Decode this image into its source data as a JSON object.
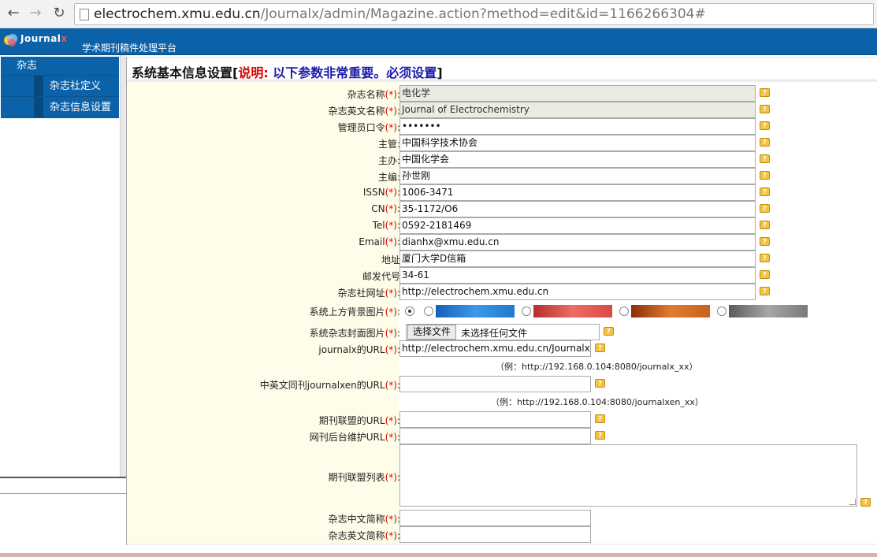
{
  "browser": {
    "url_host": "electrochem.xmu.edu.cn",
    "url_path": "/Journalx/admin/Magazine.action?method=edit&id=1166266304#"
  },
  "app": {
    "logo_text": "Journal",
    "logo_x": "x",
    "subtitle": "学术期刊稿件处理平台"
  },
  "sidebar": {
    "top": "杂志",
    "items": [
      {
        "label": "杂志社定义"
      },
      {
        "label": "杂志信息设置"
      }
    ]
  },
  "page": {
    "title_main": "系统基本信息设置[",
    "title_note": "说明:",
    "title_note_body": " 以下参数非常重要。必须设置",
    "title_end": "]"
  },
  "required_mark": "(*)",
  "help_glyph": "?",
  "fields": [
    {
      "label": "杂志名称",
      "required": true,
      "value": "电化学",
      "readonly": true
    },
    {
      "label": "杂志英文名称",
      "required": true,
      "value": "Journal of Electrochemistry",
      "readonly": true
    },
    {
      "label": "管理员口令",
      "required": true,
      "value": "•••••••",
      "readonly": false
    },
    {
      "label": "主管",
      "required": false,
      "value": "中国科学技术协会",
      "readonly": false
    },
    {
      "label": "主办",
      "required": false,
      "value": "中国化学会",
      "readonly": false
    },
    {
      "label": "主编",
      "required": false,
      "value": "孙世刚",
      "readonly": false
    },
    {
      "label": "ISSN",
      "required": true,
      "value": "1006-3471",
      "readonly": false
    },
    {
      "label": "CN",
      "required": true,
      "value": "35-1172/O6",
      "readonly": false
    },
    {
      "label": "Tel",
      "required": true,
      "value": "0592-2181469",
      "readonly": false
    },
    {
      "label": "Email",
      "required": true,
      "value": "dianhx@xmu.edu.cn",
      "readonly": false
    },
    {
      "label": "地址",
      "required": false,
      "value": "厦门大学D信箱",
      "readonly": false
    },
    {
      "label": "邮发代号",
      "required": false,
      "value": "34-61",
      "readonly": false
    },
    {
      "label": "杂志社网址",
      "required": true,
      "value": "http://electrochem.xmu.edu.cn",
      "readonly": false
    }
  ],
  "bg_image": {
    "label": "系统上方背景图片",
    "selected_index": 0,
    "swatch_colors": [
      "#1f7ad0",
      "#d94a46",
      "#c9621d",
      "#7a7a7a"
    ]
  },
  "cover_image": {
    "label": "系统杂志封面图片",
    "button": "选择文件",
    "status": "未选择任何文件"
  },
  "journalx_url": {
    "label": "journalx的URL",
    "value": "http://electrochem.xmu.edu.cn/Journalx",
    "example": "（例：http://192.168.0.104:8080/journalx_xx）"
  },
  "journalxen_url": {
    "label": "中英文同刊journalxen的URL",
    "value": "",
    "example": "（例：http://192.168.0.104:8080/journalxen_xx）"
  },
  "more_fields": [
    {
      "label": "期刊联盟的URL",
      "value": ""
    },
    {
      "label": "网刊后台维护URL",
      "value": ""
    }
  ],
  "union_list": {
    "label": "期刊联盟列表"
  },
  "abbr_fields": [
    {
      "label": "杂志中文简称",
      "value": ""
    },
    {
      "label": "杂志英文简称",
      "value": ""
    }
  ]
}
